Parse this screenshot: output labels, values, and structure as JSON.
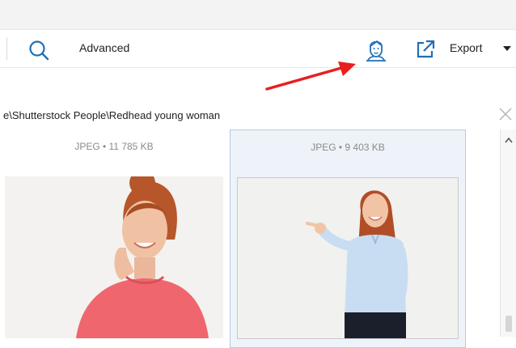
{
  "toolbar": {
    "advanced_label": "Advanced",
    "export_label": "Export",
    "icons": [
      "search-icon",
      "face-recognition-icon",
      "export-icon",
      "caret-down-icon"
    ]
  },
  "path": {
    "text": "e\\Shutterstock People\\Redhead young woman"
  },
  "gallery": {
    "items": [
      {
        "meta": "JPEG • 11 785 KB",
        "selected": false
      },
      {
        "meta": "JPEG • 9 403 KB",
        "selected": true
      }
    ]
  },
  "colors": {
    "accent": "#1f6fb6",
    "selection_bg": "#eef3f9",
    "selection_border": "#b9c9dc",
    "annotation_arrow": "#e81f1f"
  }
}
